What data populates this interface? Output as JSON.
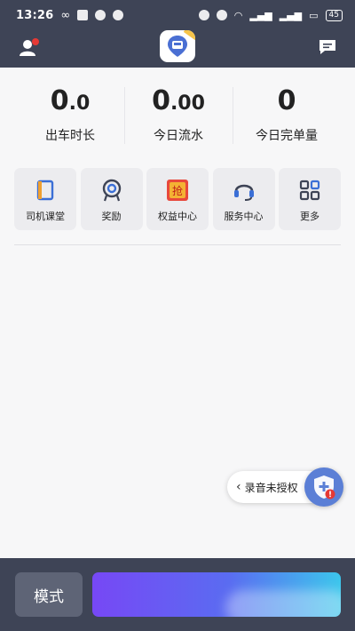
{
  "status_bar": {
    "time": "13:26",
    "battery": "45"
  },
  "stats": [
    {
      "value_main": "0",
      "value_small": ".0",
      "label": "出车时长"
    },
    {
      "value_main": "0",
      "value_small": ".00",
      "label": "今日流水"
    },
    {
      "value_main": "0",
      "value_small": "",
      "label": "今日完单量"
    }
  ],
  "tiles": [
    {
      "label": "司机课堂",
      "icon": "book-icon"
    },
    {
      "label": "奖励",
      "icon": "reward-icon"
    },
    {
      "label": "权益中心",
      "icon": "grab-badge-icon"
    },
    {
      "label": "服务中心",
      "icon": "headset-icon"
    },
    {
      "label": "更多",
      "icon": "grid-more-icon"
    }
  ],
  "float": {
    "record_label": "录音未授权"
  },
  "bottom": {
    "mode_label": "模式"
  },
  "colors": {
    "header": "#3e4456",
    "accent": "#5b7fd6",
    "badge": "#e53935"
  }
}
